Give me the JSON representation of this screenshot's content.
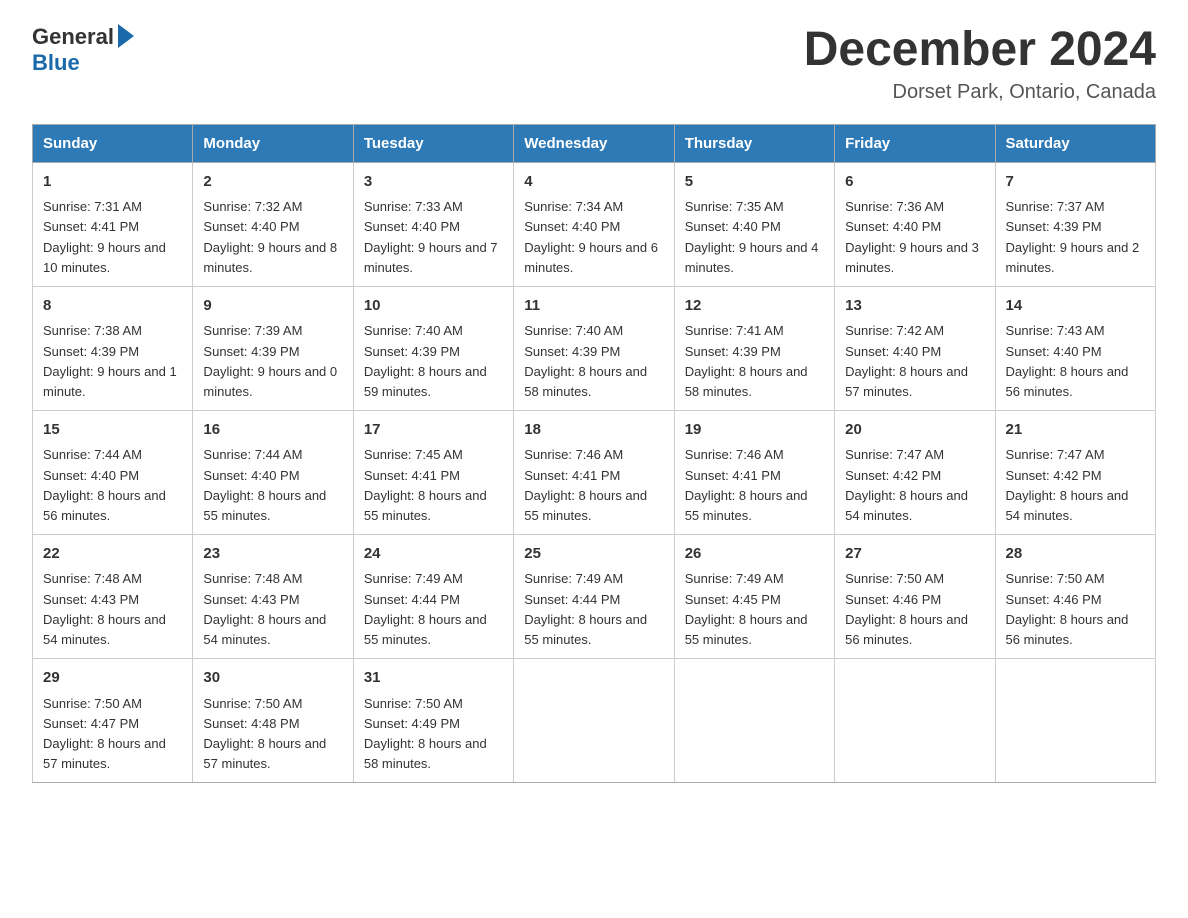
{
  "logo": {
    "general": "General",
    "blue": "Blue"
  },
  "header": {
    "title": "December 2024",
    "location": "Dorset Park, Ontario, Canada"
  },
  "weekdays": [
    "Sunday",
    "Monday",
    "Tuesday",
    "Wednesday",
    "Thursday",
    "Friday",
    "Saturday"
  ],
  "weeks": [
    [
      {
        "day": "1",
        "sunrise": "7:31 AM",
        "sunset": "4:41 PM",
        "daylight": "9 hours and 10 minutes."
      },
      {
        "day": "2",
        "sunrise": "7:32 AM",
        "sunset": "4:40 PM",
        "daylight": "9 hours and 8 minutes."
      },
      {
        "day": "3",
        "sunrise": "7:33 AM",
        "sunset": "4:40 PM",
        "daylight": "9 hours and 7 minutes."
      },
      {
        "day": "4",
        "sunrise": "7:34 AM",
        "sunset": "4:40 PM",
        "daylight": "9 hours and 6 minutes."
      },
      {
        "day": "5",
        "sunrise": "7:35 AM",
        "sunset": "4:40 PM",
        "daylight": "9 hours and 4 minutes."
      },
      {
        "day": "6",
        "sunrise": "7:36 AM",
        "sunset": "4:40 PM",
        "daylight": "9 hours and 3 minutes."
      },
      {
        "day": "7",
        "sunrise": "7:37 AM",
        "sunset": "4:39 PM",
        "daylight": "9 hours and 2 minutes."
      }
    ],
    [
      {
        "day": "8",
        "sunrise": "7:38 AM",
        "sunset": "4:39 PM",
        "daylight": "9 hours and 1 minute."
      },
      {
        "day": "9",
        "sunrise": "7:39 AM",
        "sunset": "4:39 PM",
        "daylight": "9 hours and 0 minutes."
      },
      {
        "day": "10",
        "sunrise": "7:40 AM",
        "sunset": "4:39 PM",
        "daylight": "8 hours and 59 minutes."
      },
      {
        "day": "11",
        "sunrise": "7:40 AM",
        "sunset": "4:39 PM",
        "daylight": "8 hours and 58 minutes."
      },
      {
        "day": "12",
        "sunrise": "7:41 AM",
        "sunset": "4:39 PM",
        "daylight": "8 hours and 58 minutes."
      },
      {
        "day": "13",
        "sunrise": "7:42 AM",
        "sunset": "4:40 PM",
        "daylight": "8 hours and 57 minutes."
      },
      {
        "day": "14",
        "sunrise": "7:43 AM",
        "sunset": "4:40 PM",
        "daylight": "8 hours and 56 minutes."
      }
    ],
    [
      {
        "day": "15",
        "sunrise": "7:44 AM",
        "sunset": "4:40 PM",
        "daylight": "8 hours and 56 minutes."
      },
      {
        "day": "16",
        "sunrise": "7:44 AM",
        "sunset": "4:40 PM",
        "daylight": "8 hours and 55 minutes."
      },
      {
        "day": "17",
        "sunrise": "7:45 AM",
        "sunset": "4:41 PM",
        "daylight": "8 hours and 55 minutes."
      },
      {
        "day": "18",
        "sunrise": "7:46 AM",
        "sunset": "4:41 PM",
        "daylight": "8 hours and 55 minutes."
      },
      {
        "day": "19",
        "sunrise": "7:46 AM",
        "sunset": "4:41 PM",
        "daylight": "8 hours and 55 minutes."
      },
      {
        "day": "20",
        "sunrise": "7:47 AM",
        "sunset": "4:42 PM",
        "daylight": "8 hours and 54 minutes."
      },
      {
        "day": "21",
        "sunrise": "7:47 AM",
        "sunset": "4:42 PM",
        "daylight": "8 hours and 54 minutes."
      }
    ],
    [
      {
        "day": "22",
        "sunrise": "7:48 AM",
        "sunset": "4:43 PM",
        "daylight": "8 hours and 54 minutes."
      },
      {
        "day": "23",
        "sunrise": "7:48 AM",
        "sunset": "4:43 PM",
        "daylight": "8 hours and 54 minutes."
      },
      {
        "day": "24",
        "sunrise": "7:49 AM",
        "sunset": "4:44 PM",
        "daylight": "8 hours and 55 minutes."
      },
      {
        "day": "25",
        "sunrise": "7:49 AM",
        "sunset": "4:44 PM",
        "daylight": "8 hours and 55 minutes."
      },
      {
        "day": "26",
        "sunrise": "7:49 AM",
        "sunset": "4:45 PM",
        "daylight": "8 hours and 55 minutes."
      },
      {
        "day": "27",
        "sunrise": "7:50 AM",
        "sunset": "4:46 PM",
        "daylight": "8 hours and 56 minutes."
      },
      {
        "day": "28",
        "sunrise": "7:50 AM",
        "sunset": "4:46 PM",
        "daylight": "8 hours and 56 minutes."
      }
    ],
    [
      {
        "day": "29",
        "sunrise": "7:50 AM",
        "sunset": "4:47 PM",
        "daylight": "8 hours and 57 minutes."
      },
      {
        "day": "30",
        "sunrise": "7:50 AM",
        "sunset": "4:48 PM",
        "daylight": "8 hours and 57 minutes."
      },
      {
        "day": "31",
        "sunrise": "7:50 AM",
        "sunset": "4:49 PM",
        "daylight": "8 hours and 58 minutes."
      },
      null,
      null,
      null,
      null
    ]
  ]
}
